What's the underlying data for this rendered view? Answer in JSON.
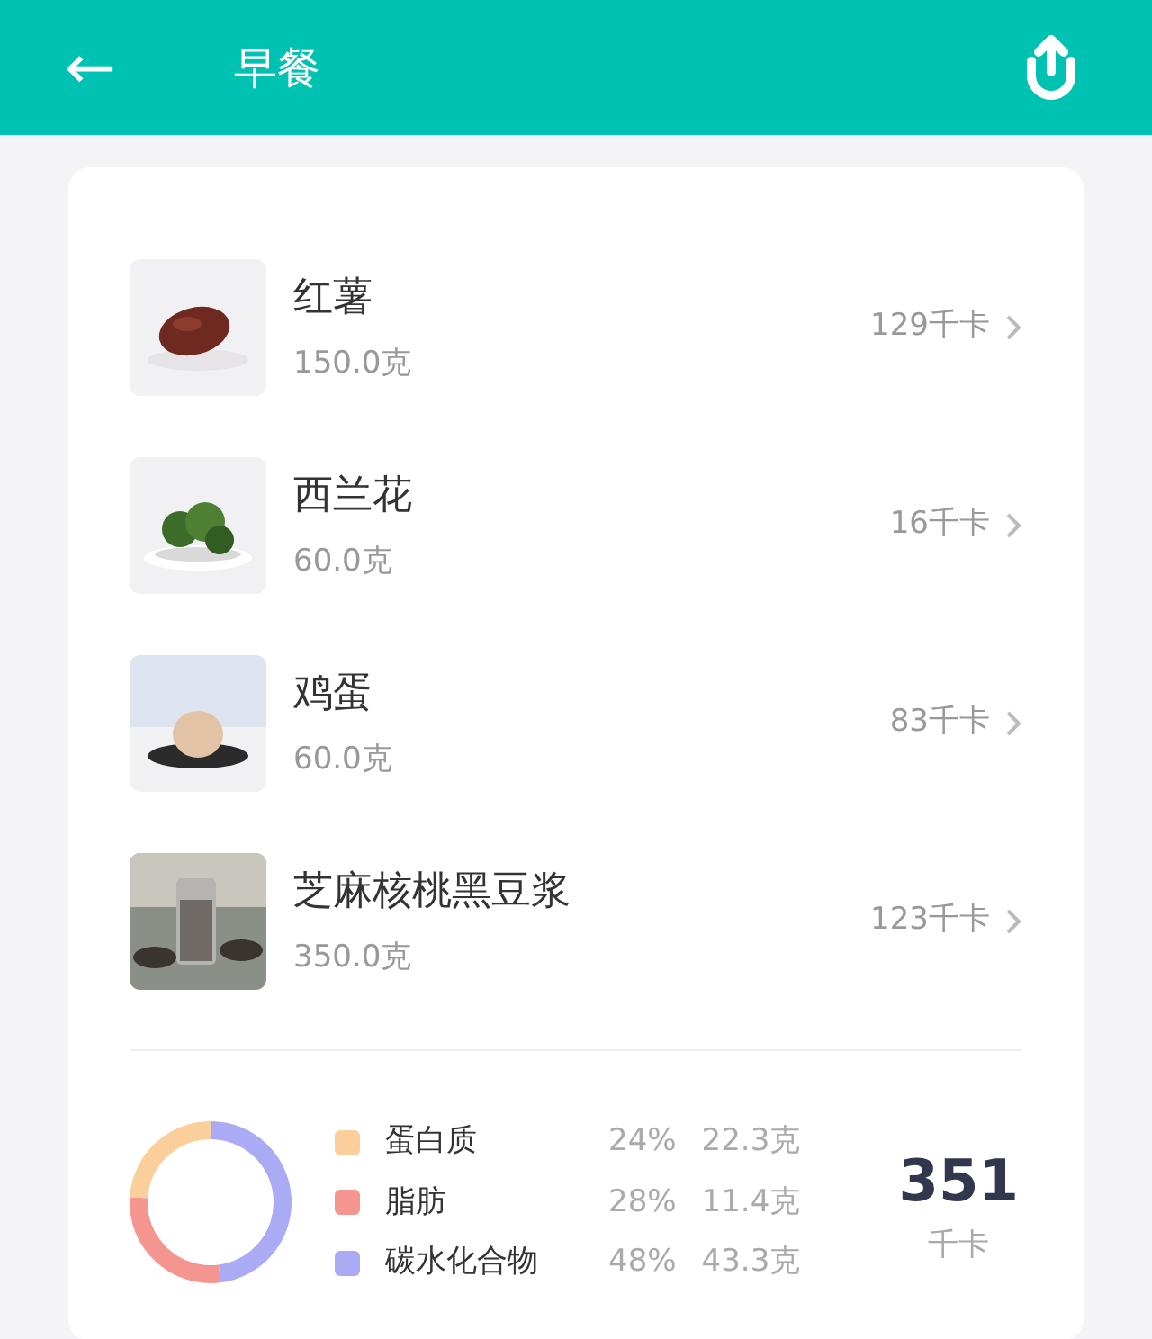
{
  "header": {
    "back": "←",
    "title": "早餐"
  },
  "foods": [
    {
      "name": "红薯",
      "amount": "150.0克",
      "calories": "129千卡"
    },
    {
      "name": "西兰花",
      "amount": "60.0克",
      "calories": "16千卡"
    },
    {
      "name": "鸡蛋",
      "amount": "60.0克",
      "calories": "83千卡"
    },
    {
      "name": "芝麻核桃黑豆浆",
      "amount": "350.0克",
      "calories": "123千卡"
    }
  ],
  "nutrients": [
    {
      "percent": "24%",
      "grams": "22.3克",
      "color": "#fbcf9c"
    },
    {
      "percent": "28%",
      "grams": "11.4克",
      "color": "#f5958f"
    },
    {
      "percent": "48%",
      "grams": "43.3克",
      "color": "#aaaaf5"
    }
  ],
  "chart_data": {
    "type": "donut",
    "categories": [
      "蛋白质",
      "脂肪",
      "碳水化合物"
    ],
    "values": [
      24,
      28,
      48
    ],
    "legend": "right"
  },
  "total": {
    "value": "351",
    "unit": "千卡"
  }
}
